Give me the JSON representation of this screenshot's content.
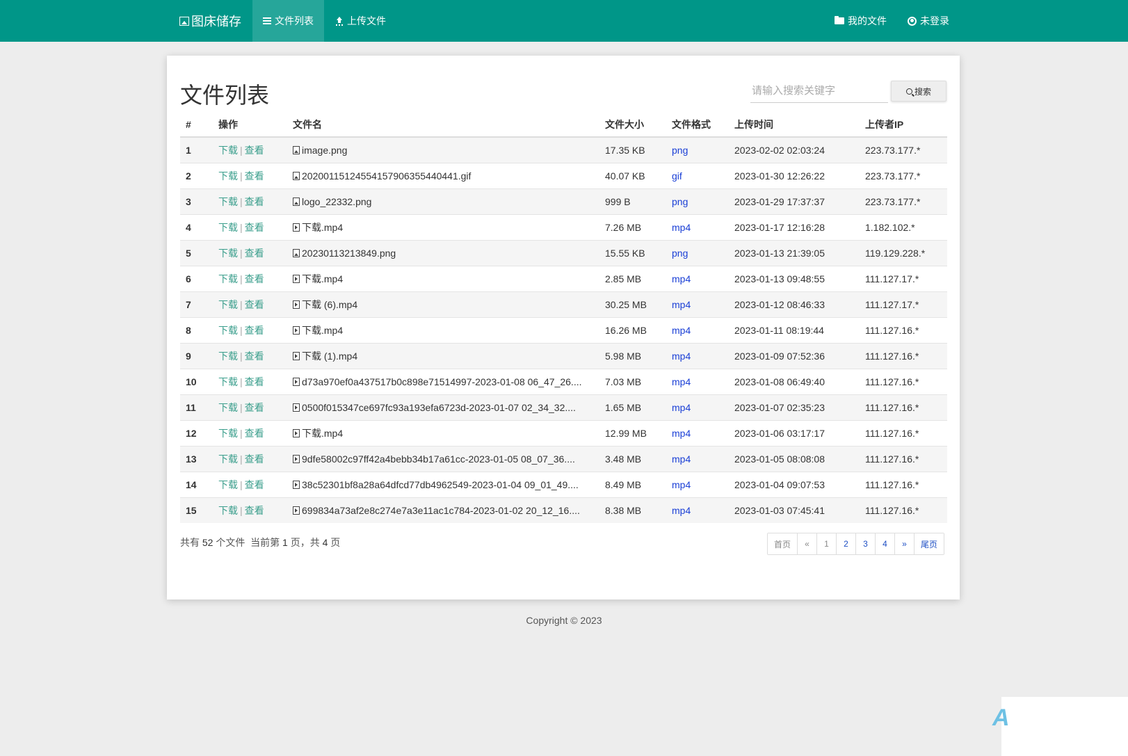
{
  "navbar": {
    "brand": "图床储存",
    "items": [
      {
        "label": "文件列表",
        "icon": "list-icon"
      },
      {
        "label": "上传文件",
        "icon": "upload-icon"
      }
    ],
    "right_items": [
      {
        "label": "我的文件",
        "icon": "folder-open-icon"
      },
      {
        "label": "未登录",
        "icon": "user-circle-icon"
      }
    ],
    "colors": {
      "bar": "#009688",
      "active": "#26a69a"
    }
  },
  "page": {
    "title": "文件列表",
    "search": {
      "placeholder": "请输入搜索关键字",
      "button_label": "搜索",
      "icon": "search-icon"
    }
  },
  "table": {
    "headers": [
      "#",
      "操作",
      "文件名",
      "文件大小",
      "文件格式",
      "上传时间",
      "上传者IP"
    ],
    "actions": {
      "download": "下载",
      "separator": "|",
      "view": "查看"
    },
    "rows": [
      {
        "no": "1",
        "name": "image.png",
        "size": "17.35 KB",
        "format": "png",
        "time": "2023-02-02 02:03:24",
        "ip": "223.73.177.*"
      },
      {
        "no": "2",
        "name": "20200115124554157906355440441.gif",
        "size": "40.07 KB",
        "format": "gif",
        "time": "2023-01-30 12:26:22",
        "ip": "223.73.177.*"
      },
      {
        "no": "3",
        "name": "logo_22332.png",
        "size": "999 B",
        "format": "png",
        "time": "2023-01-29 17:37:37",
        "ip": "223.73.177.*"
      },
      {
        "no": "4",
        "name": "下载.mp4",
        "size": "7.26 MB",
        "format": "mp4",
        "time": "2023-01-17 12:16:28",
        "ip": "1.182.102.*"
      },
      {
        "no": "5",
        "name": "20230113213849.png",
        "size": "15.55 KB",
        "format": "png",
        "time": "2023-01-13 21:39:05",
        "ip": "119.129.228.*"
      },
      {
        "no": "6",
        "name": "下载.mp4",
        "size": "2.85 MB",
        "format": "mp4",
        "time": "2023-01-13 09:48:55",
        "ip": "111.127.17.*"
      },
      {
        "no": "7",
        "name": "下载 (6).mp4",
        "size": "30.25 MB",
        "format": "mp4",
        "time": "2023-01-12 08:46:33",
        "ip": "111.127.17.*"
      },
      {
        "no": "8",
        "name": "下载.mp4",
        "size": "16.26 MB",
        "format": "mp4",
        "time": "2023-01-11 08:19:44",
        "ip": "111.127.16.*"
      },
      {
        "no": "9",
        "name": "下载 (1).mp4",
        "size": "5.98 MB",
        "format": "mp4",
        "time": "2023-01-09 07:52:36",
        "ip": "111.127.16.*"
      },
      {
        "no": "10",
        "name": "d73a970ef0a437517b0c898e71514997-2023-01-08 06_47_26....",
        "size": "7.03 MB",
        "format": "mp4",
        "time": "2023-01-08 06:49:40",
        "ip": "111.127.16.*"
      },
      {
        "no": "11",
        "name": "0500f015347ce697fc93a193efa6723d-2023-01-07 02_34_32....",
        "size": "1.65 MB",
        "format": "mp4",
        "time": "2023-01-07 02:35:23",
        "ip": "111.127.16.*"
      },
      {
        "no": "12",
        "name": "下载.mp4",
        "size": "12.99 MB",
        "format": "mp4",
        "time": "2023-01-06 03:17:17",
        "ip": "111.127.16.*"
      },
      {
        "no": "13",
        "name": "9dfe58002c97ff42a4bebb34b17a61cc-2023-01-05 08_07_36....",
        "size": "3.48 MB",
        "format": "mp4",
        "time": "2023-01-05 08:08:08",
        "ip": "111.127.16.*"
      },
      {
        "no": "14",
        "name": "38c52301bf8a28a64dfcd77db4962549-2023-01-04 09_01_49....",
        "size": "8.49 MB",
        "format": "mp4",
        "time": "2023-01-04 09:07:53",
        "ip": "111.127.16.*"
      },
      {
        "no": "15",
        "name": "699834a73af2e8c274e7a3e11ac1c784-2023-01-02 20_12_16....",
        "size": "8.38 MB",
        "format": "mp4",
        "time": "2023-01-03 07:45:41",
        "ip": "111.127.16.*"
      }
    ]
  },
  "summary": {
    "prefix": "共有",
    "total": "52",
    "mid1": "个文件  当前第",
    "current": "1",
    "mid2": "页，共",
    "pages": "4",
    "suffix": "页"
  },
  "pagination": [
    "首页",
    "«",
    "1",
    "2",
    "3",
    "4",
    "»",
    "尾页"
  ],
  "footer": {
    "text": "Copyright © 2023"
  }
}
